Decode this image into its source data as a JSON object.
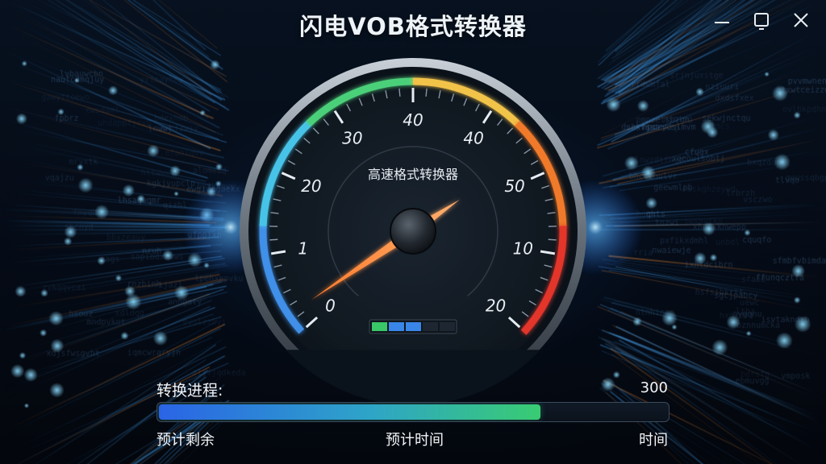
{
  "window": {
    "title": "闪电VOB格式转换器",
    "controls": [
      "minimize-icon",
      "restore-icon",
      "close-icon"
    ]
  },
  "gauge": {
    "center_label": "高速格式转换器",
    "tick_labels": [
      "0",
      "1",
      "20",
      "30",
      "40",
      "40",
      "50",
      "10",
      "20"
    ],
    "needle_level": 0.03,
    "indicator_segments": [
      {
        "state": "green"
      },
      {
        "state": "blue"
      },
      {
        "state": "blue"
      },
      {
        "state": "off"
      },
      {
        "state": "off"
      }
    ],
    "arc_colors": [
      "#3f8fe8",
      "#46c3e8",
      "#4cd07a",
      "#f2c34a",
      "#f07a2a",
      "#e3342b"
    ]
  },
  "progress": {
    "label": "转换进程:",
    "value_text": "300",
    "fill_fraction": 0.75,
    "footer_left": "预计剩余",
    "footer_center": "预计时间",
    "footer_right": "时间"
  },
  "colors": {
    "bar_start": "#2a64e6",
    "bar_end": "#39cc72",
    "needle": "#ff6a1a"
  }
}
